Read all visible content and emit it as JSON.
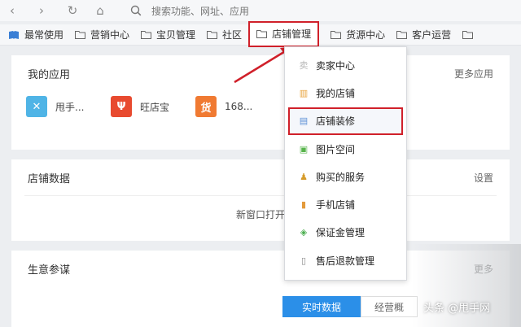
{
  "browser": {
    "back_glyph": "‹",
    "forward_glyph": "›",
    "refresh_glyph": "↻",
    "home_glyph": "⌂",
    "omnibox_placeholder": "搜索功能、网址、应用"
  },
  "bookmarks": [
    {
      "label": "最常使用",
      "icon": "book-icon"
    },
    {
      "label": "营销中心",
      "icon": "folder-icon"
    },
    {
      "label": "宝贝管理",
      "icon": "folder-icon"
    },
    {
      "label": "社区",
      "icon": "folder-icon"
    },
    {
      "label": "店铺管理",
      "icon": "folder-icon",
      "highlighted": true
    },
    {
      "label": "货源中心",
      "icon": "folder-icon"
    },
    {
      "label": "客户运营",
      "icon": "folder-icon"
    }
  ],
  "apps_panel": {
    "title": "我的应用",
    "more": "更多应用",
    "apps": [
      {
        "label": "甩手...",
        "icon_text": "✕",
        "color": "#4fb4e6"
      },
      {
        "label": "旺店宝",
        "icon_text": "Ψ",
        "color": "#e84a2f"
      },
      {
        "label": "168...",
        "icon_text": "货",
        "color": "#f07a32"
      }
    ]
  },
  "store_panel": {
    "title": "店铺数据",
    "settings": "设置",
    "new_window": "新窗口打开"
  },
  "biz_panel": {
    "title": "生意参谋",
    "more": "更多",
    "tabs": [
      "实时数据",
      "经营概"
    ]
  },
  "dropdown": {
    "items": [
      {
        "label": "卖家中心",
        "icon": "seller-icon",
        "glyph": "卖",
        "color": "#b8b8b8"
      },
      {
        "label": "我的店铺",
        "icon": "shop-icon",
        "glyph": "▥",
        "color": "#e8a23a"
      },
      {
        "label": "店铺装修",
        "icon": "decorate-icon",
        "glyph": "▤",
        "color": "#5b8fd6",
        "highlighted": true
      },
      {
        "label": "图片空间",
        "icon": "image-icon",
        "glyph": "▣",
        "color": "#58b44c"
      },
      {
        "label": "购买的服务",
        "icon": "service-icon",
        "glyph": "♟",
        "color": "#d69b2a"
      },
      {
        "label": "手机店铺",
        "icon": "mobile-icon",
        "glyph": "▮",
        "color": "#e39a3b"
      },
      {
        "label": "保证金管理",
        "icon": "deposit-icon",
        "glyph": "◈",
        "color": "#4caf50"
      },
      {
        "label": "售后退款管理",
        "icon": "refund-icon",
        "glyph": "▯",
        "color": "#888888"
      }
    ]
  },
  "watermark": "头条 @甩手网",
  "colors": {
    "highlight_red": "#d0202a",
    "accent_blue": "#2b8fe8"
  }
}
